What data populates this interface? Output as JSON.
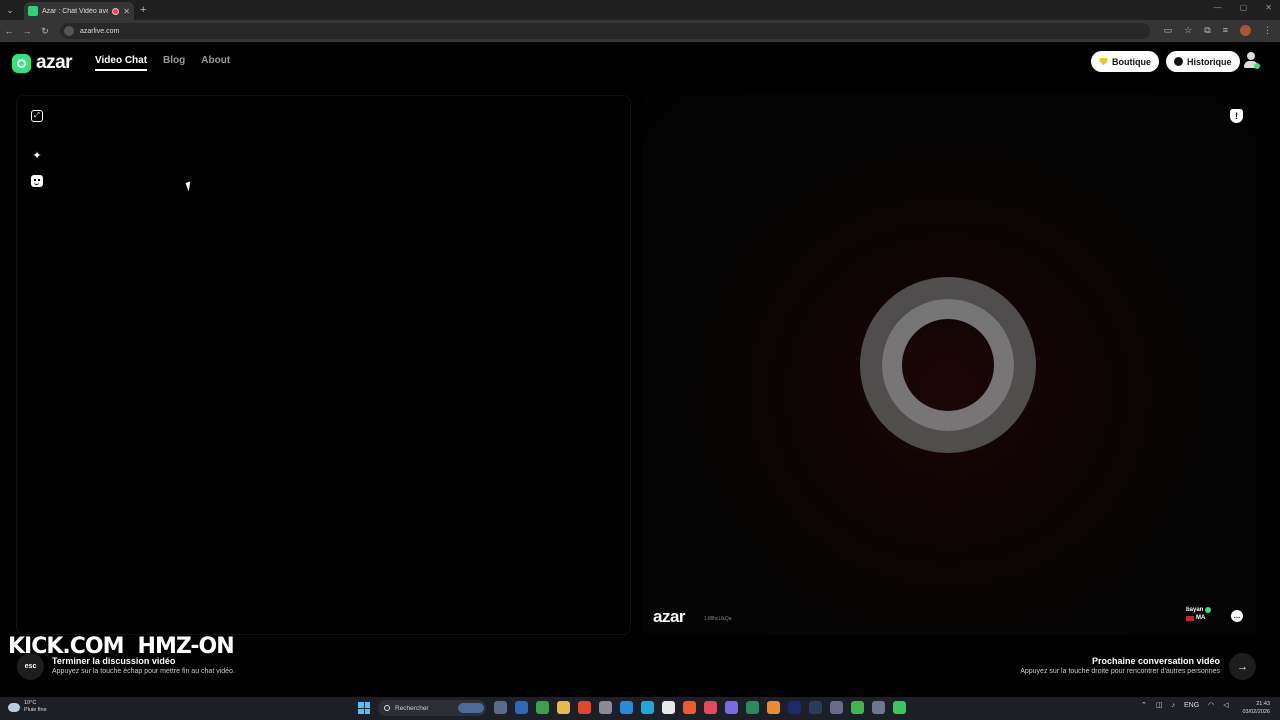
{
  "browser": {
    "tab_title": "Azar : Chat Vidéo avec de n",
    "url": "azarlive.com"
  },
  "header": {
    "logo_text": "azar",
    "nav": [
      {
        "label": "Video Chat"
      },
      {
        "label": "Blog"
      },
      {
        "label": "About"
      }
    ],
    "boutique_label": "Boutique",
    "historique_label": "Historique"
  },
  "remote_panel": {
    "logo_text": "azar",
    "partner_id": "1:l8lhcLlkQa",
    "partner_name": "bayan",
    "partner_country": "MA"
  },
  "bottom": {
    "esc_key": "esc",
    "end_title": "Terminer la discussion vidéo",
    "end_desc": "Appuyez sur la touche échap pour mettre fin au chat vidéo.",
    "next_title": "Prochaine conversation vidéo",
    "next_desc": "Appuyez sur la touche droite pour rencontrer d'autres personnes"
  },
  "watermark": {
    "kick": "KICK.COM",
    "channel": "HMZ-ON"
  },
  "taskbar": {
    "weather_temp": "10°C",
    "weather_desc": "Pluie fine",
    "search_placeholder": "Rechercher",
    "language": "ENG",
    "time": "21:43",
    "date": "03/02/2026",
    "app_colors": [
      "#5a6b8a",
      "#2a6ab8",
      "#3aa04a",
      "#e8b84a",
      "#e04a2a",
      "#8a8a9a",
      "#2a8ad8",
      "#1fa8e0",
      "#e8e8e8",
      "#f05a2a",
      "#e04a5a",
      "#7a6ae8",
      "#2a8a5a",
      "#f08a2a",
      "#1a2a6a",
      "#2a3a5a",
      "#6a6a8a",
      "#3ab84a",
      "#6a7a8a",
      "#3ac85a"
    ]
  }
}
